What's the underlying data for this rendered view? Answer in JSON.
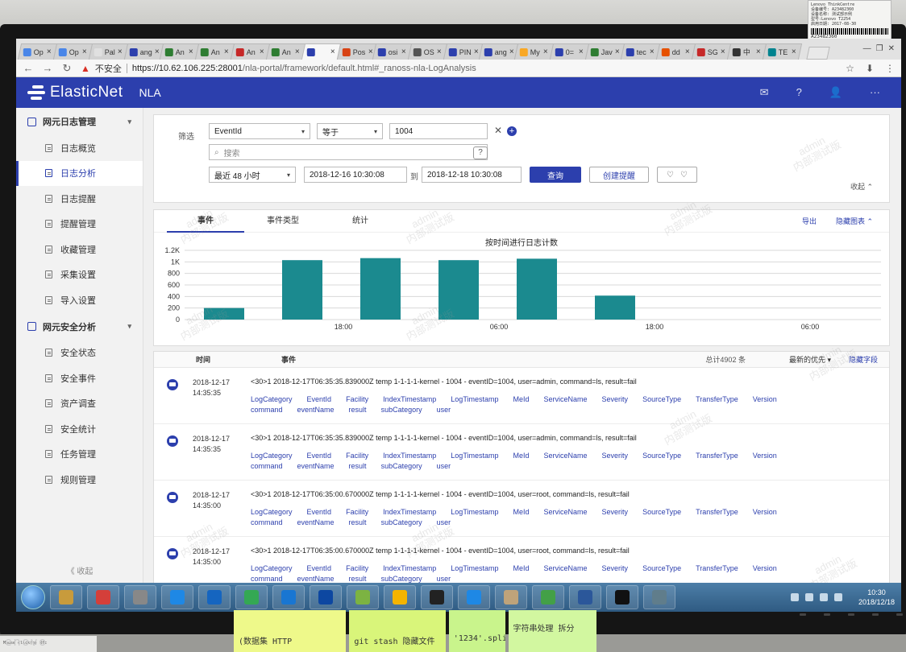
{
  "sticker": {
    "lines": [
      "Lenovo ThinkCentre",
      "设备编号: A23482360",
      "设备名称: 测试部示例",
      "型号:Lenovo T2254",
      "启用日期: 2017-08-30"
    ],
    "code": "A23482360"
  },
  "browser": {
    "tabs": [
      {
        "label": "Op",
        "color": "#4a86e8"
      },
      {
        "label": "Op",
        "color": "#4a86e8"
      },
      {
        "label": "Pal",
        "color": "#e0e0e0"
      },
      {
        "label": "ang",
        "color": "#2c3fad"
      },
      {
        "label": "An",
        "color": "#2e7d32"
      },
      {
        "label": "An",
        "color": "#2e7d32"
      },
      {
        "label": "An",
        "color": "#c62828"
      },
      {
        "label": "An",
        "color": "#2e7d32"
      },
      {
        "label": "",
        "color": "#2c3fad",
        "active": true
      },
      {
        "label": "Pos",
        "color": "#d84315"
      },
      {
        "label": "osi",
        "color": "#2c3fad"
      },
      {
        "label": "OS",
        "color": "#555555"
      },
      {
        "label": "PIN",
        "color": "#2c3fad"
      },
      {
        "label": "ang",
        "color": "#2c3fad"
      },
      {
        "label": "My",
        "color": "#f9a825"
      },
      {
        "label": "0=",
        "color": "#2c3fad"
      },
      {
        "label": "Jav",
        "color": "#2e7d32"
      },
      {
        "label": "tec",
        "color": "#2c3fad"
      },
      {
        "label": "dd",
        "color": "#e65100"
      },
      {
        "label": "SG",
        "color": "#c62828"
      },
      {
        "label": "中",
        "color": "#333333"
      },
      {
        "label": "TE",
        "color": "#00838f"
      }
    ],
    "insecure_label": "不安全",
    "url_host": "https://10.62.106.225:28001",
    "url_path": "/nla-portal/framework/default.html#_ranoss-nla-LogAnalysis"
  },
  "app": {
    "brand": "ElasticNet",
    "product": "NLA"
  },
  "sidebar": {
    "group1": "网元日志管理",
    "items1": [
      "日志概览",
      "日志分析",
      "日志提醒",
      "提醒管理",
      "收藏管理",
      "采集设置",
      "导入设置"
    ],
    "group2": "网元安全分析",
    "items2": [
      "安全状态",
      "安全事件",
      "资产调查",
      "安全统计",
      "任务管理",
      "规则管理"
    ],
    "collapse": "《 收起"
  },
  "filter": {
    "label": "筛选",
    "field": "EventId",
    "operator": "等于",
    "value": "1004",
    "search_placeholder": "搜索",
    "range": "最近 48 小时",
    "start": "2018-12-16 10:30:08",
    "to": "到",
    "end": "2018-12-18 10:30:08",
    "query_btn": "查询",
    "create_alert_btn": "创建提醒",
    "collapse": "收起 ⌃"
  },
  "chart_tabs": {
    "tabs": [
      "事件",
      "事件类型",
      "统计"
    ],
    "export": "导出",
    "hide_chart": "隐藏图表 ⌃"
  },
  "chart_data": {
    "type": "bar",
    "title": "按时间进行日志计数",
    "y_ticks": [
      "0",
      "200",
      "400",
      "600",
      "800",
      "1K",
      "1.2K"
    ],
    "x_ticks": [
      "18:00",
      "06:00",
      "18:00",
      "06:00"
    ],
    "ylim": [
      0,
      1200
    ],
    "values": [
      200,
      1030,
      1065,
      1030,
      1055,
      415
    ],
    "color": "#1b8a8f"
  },
  "list": {
    "col_time": "时间",
    "col_event": "事件",
    "total": "总计4902 条",
    "sort": "最新的优先 ▾",
    "hide_fields": "隐藏字段",
    "fields": [
      "LogCategory",
      "EventId",
      "Facility",
      "IndexTimestamp",
      "LogTimestamp",
      "MeId",
      "ServiceName",
      "Severity",
      "SourceType",
      "TransferType",
      "Version",
      "command",
      "eventName",
      "result",
      "subCategory",
      "user"
    ],
    "rows": [
      {
        "date": "2018-12-17",
        "time": "14:35:35",
        "msg": "<30>1 2018-12-17T06:35:35.839000Z temp 1-1-1-1-kernel - 1004 - eventID=1004, user=admin, command=ls, result=fail"
      },
      {
        "date": "2018-12-17",
        "time": "14:35:35",
        "msg": "<30>1 2018-12-17T06:35:35.839000Z temp 1-1-1-1-kernel - 1004 - eventID=1004, user=admin, command=ls, result=fail"
      },
      {
        "date": "2018-12-17",
        "time": "14:35:00",
        "msg": "<30>1 2018-12-17T06:35:00.670000Z temp 1-1-1-1-kernel - 1004 - eventID=1004, user=root, command=ls, result=fail"
      },
      {
        "date": "2018-12-17",
        "time": "14:35:00",
        "msg": "<30>1 2018-12-17T06:35:00.670000Z temp 1-1-1-1-kernel - 1004 - eventID=1004, user=root, command=ls, result=fail"
      }
    ]
  },
  "watermark": [
    "admin",
    "内部测试版"
  ],
  "taskbar": {
    "apps": [
      "#c89b3c",
      "#d43f3a",
      "#888888",
      "#1e88e5",
      "#1565c0",
      "#34a853",
      "#1976d2",
      "#0d47a1",
      "#7cb342",
      "#f4b400",
      "#222222",
      "#1e88e5",
      "#bfa37a",
      "#43a047",
      "#2b579a",
      "#111111",
      "#607d8b"
    ],
    "clock_time": "10:30",
    "clock_date": "2018/12/18"
  },
  "notes": [
    "(数据集 HTTP",
    "git stash 隐藏文件",
    "'1234'.split('')",
    "字符串处理 拆分"
  ],
  "note_corner": "Mouse click(o)  Rfc"
}
